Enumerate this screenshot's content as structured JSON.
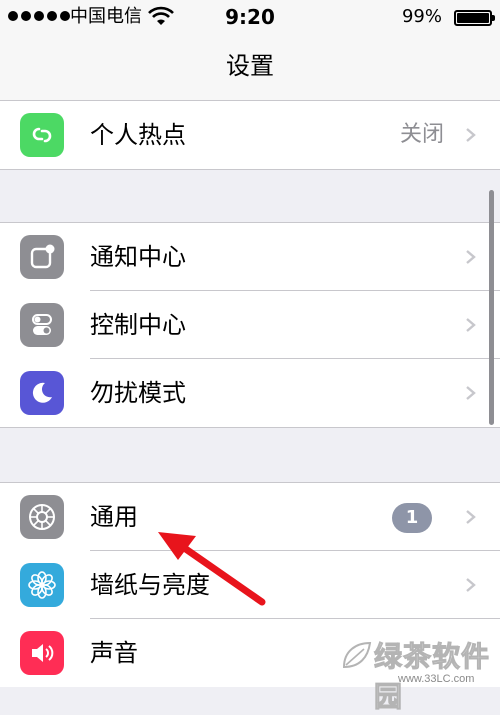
{
  "status_bar": {
    "carrier": "中国电信",
    "time": "9:20",
    "battery_percent": "99%",
    "battery_level": 0.99,
    "icons": [
      "signal-icon",
      "wifi-icon",
      "battery-icon"
    ]
  },
  "nav": {
    "title": "设置"
  },
  "groups": [
    {
      "items": [
        {
          "label": "个人热点",
          "value": "关闭",
          "icon": "hotspot-icon",
          "icon_color": "#4cd964"
        }
      ]
    },
    {
      "items": [
        {
          "label": "通知中心",
          "icon": "notification-center-icon",
          "icon_color": "#8e8e93"
        },
        {
          "label": "控制中心",
          "icon": "control-center-icon",
          "icon_color": "#8e8e93"
        },
        {
          "label": "勿扰模式",
          "icon": "moon-icon",
          "icon_color": "#5856d6"
        }
      ]
    },
    {
      "items": [
        {
          "label": "通用",
          "badge": "1",
          "icon": "gear-icon",
          "icon_color": "#8e8e93"
        },
        {
          "label": "墙纸与亮度",
          "icon": "flower-icon",
          "icon_color": "#34aadc"
        },
        {
          "label": "声音",
          "icon": "speaker-icon",
          "icon_color": "#ff2d55"
        }
      ]
    }
  ],
  "watermark": {
    "text": "绿茶软件园",
    "url": "www.33LC.com"
  },
  "colors": {
    "annotation_arrow": "#e8141c",
    "badge": "#8e95a8",
    "chevron": "#c7c7cc"
  }
}
